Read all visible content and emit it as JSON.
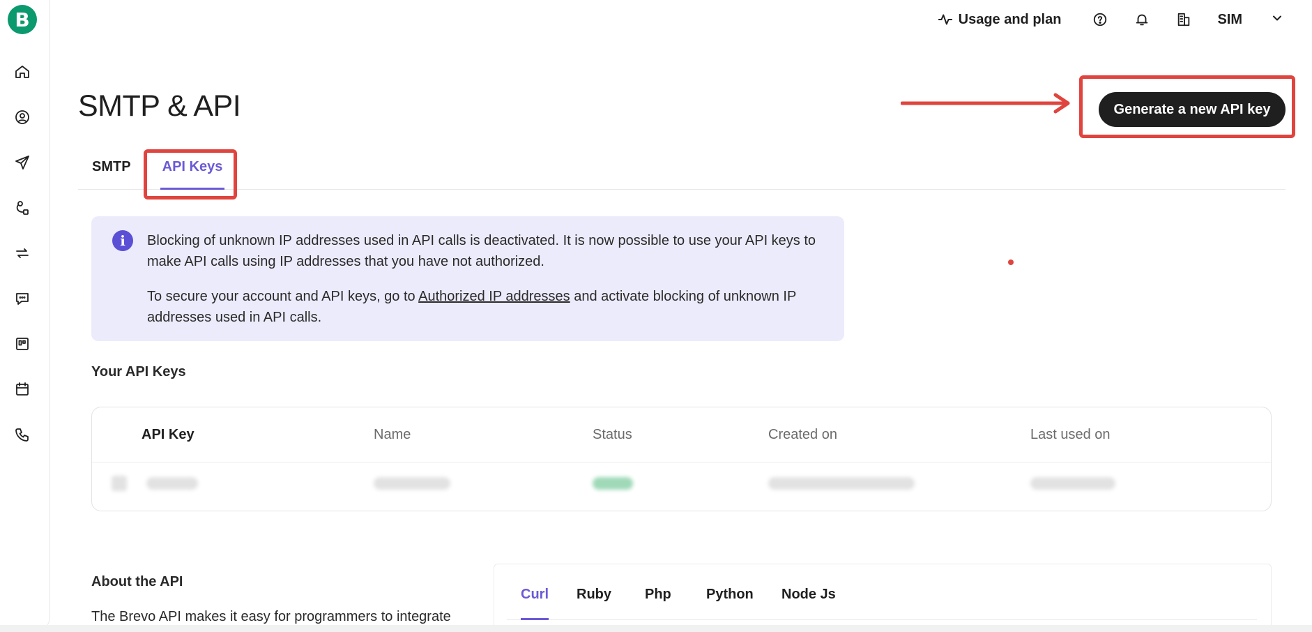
{
  "brand": {
    "logo_letter": "B",
    "logo_color": "#0b996e",
    "accent_color": "#6a5ad6"
  },
  "sidebar": {
    "items": [
      {
        "icon": "home-icon"
      },
      {
        "icon": "contacts-icon"
      },
      {
        "icon": "campaigns-icon"
      },
      {
        "icon": "automations-icon"
      },
      {
        "icon": "transactional-icon"
      },
      {
        "icon": "conversations-icon"
      },
      {
        "icon": "deals-icon"
      },
      {
        "icon": "meetings-icon"
      },
      {
        "icon": "phone-icon"
      }
    ]
  },
  "topbar": {
    "usage_label": "Usage and plan",
    "account_label": "SIM"
  },
  "page": {
    "title": "SMTP & API",
    "generate_button": "Generate a new API key"
  },
  "tabs": {
    "smtp": "SMTP",
    "api_keys": "API Keys",
    "active": "API Keys"
  },
  "info": {
    "paragraph1": "Blocking of unknown IP addresses used in API calls is deactivated. It is now possible to use your API keys to make API calls using IP addresses that you have not authorized.",
    "paragraph2_before": "To secure your account and API keys, go to ",
    "paragraph2_link": "Authorized IP addresses",
    "paragraph2_after": " and activate blocking of unknown IP addresses used in API calls."
  },
  "api_keys": {
    "section_title": "Your API Keys",
    "columns": [
      "API Key",
      "Name",
      "Status",
      "Created on",
      "Last used on"
    ]
  },
  "about": {
    "title": "About the API",
    "text": "The Brevo API makes it easy for programmers to integrate"
  },
  "code_tabs": {
    "items": [
      "Curl",
      "Ruby",
      "Php",
      "Python",
      "Node Js"
    ],
    "active": "Curl"
  }
}
